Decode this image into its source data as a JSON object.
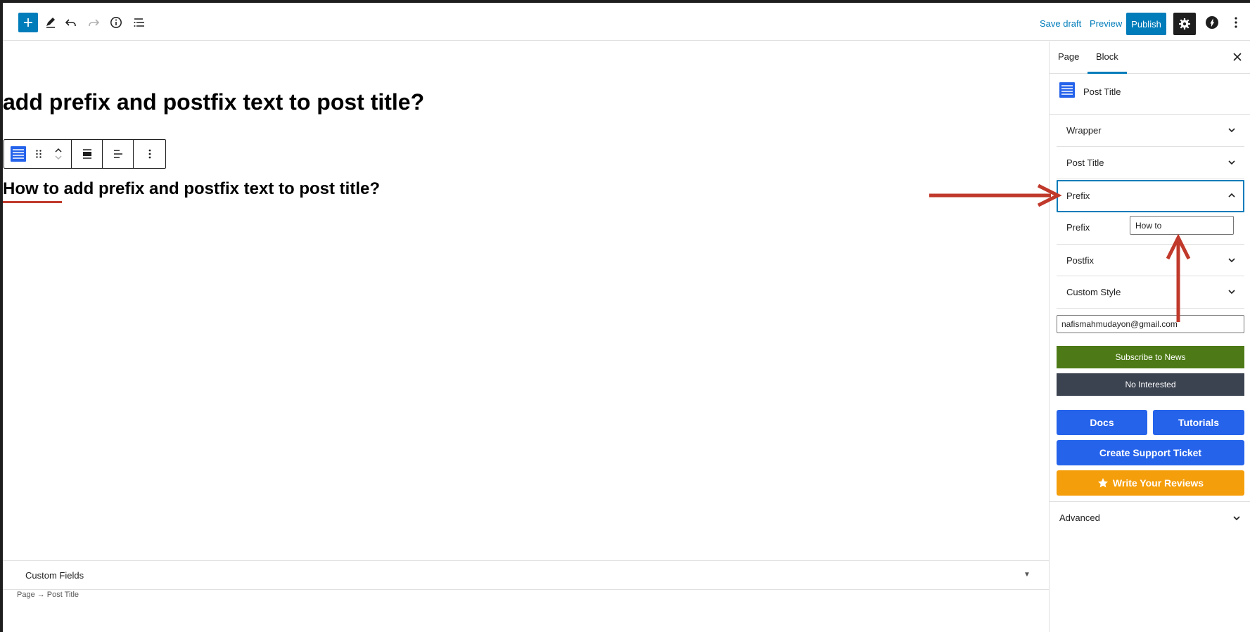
{
  "toolbar": {
    "save_draft": "Save draft",
    "preview": "Preview",
    "publish": "Publish"
  },
  "editor": {
    "page_heading": "add prefix and postfix text to post title?",
    "post_title_rendered": "How to add prefix and postfix text to post title?",
    "prefix_shown": "How to"
  },
  "footer": {
    "custom_fields": "Custom Fields",
    "breadcrumb": "Page → Post Title"
  },
  "sidebar": {
    "tabs": [
      {
        "label": "Page"
      },
      {
        "label": "Block"
      }
    ],
    "active_tab": "Block",
    "block_title": "Post Title",
    "panels": [
      {
        "label": "Wrapper"
      },
      {
        "label": "Post Title"
      },
      {
        "label": "Prefix"
      },
      {
        "label": "Postfix"
      },
      {
        "label": "Custom Style"
      }
    ],
    "prefix_field": {
      "label": "Prefix",
      "value": "How to"
    },
    "email_value": "nafismahmudayon@gmail.com",
    "subscribe": "Subscribe to News",
    "no_interested": "No Interested",
    "docs": "Docs",
    "tutorials": "Tutorials",
    "support": "Create Support Ticket",
    "reviews": "Write Your Reviews",
    "advanced": "Advanced"
  },
  "colors": {
    "accent": "#007cba",
    "subscribe_green": "#4d7a16",
    "no_interest_gray": "#3b4250",
    "action_blue": "#2563eb",
    "review_orange": "#f59e0b",
    "annotation_red": "#c0392b"
  },
  "icons": [
    "plus-icon",
    "pencil-icon",
    "undo-icon",
    "redo-icon",
    "info-icon",
    "list-view-icon",
    "gear-icon",
    "jetpack-icon",
    "more-vertical-icon",
    "close-icon",
    "chevron-down-icon",
    "chevron-up-icon",
    "star-icon"
  ]
}
